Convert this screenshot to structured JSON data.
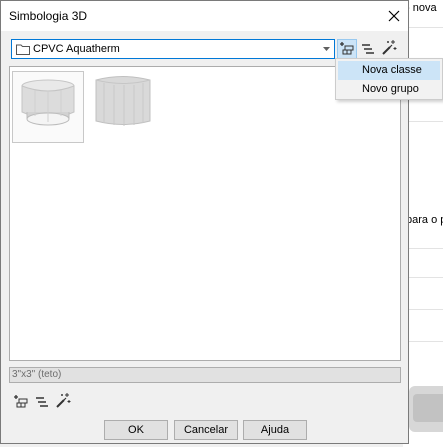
{
  "dialog": {
    "title": "Simbologia 3D",
    "library_combo": {
      "value": "CPVC Aquatherm"
    },
    "toolbar_top": [
      "new-class-icon",
      "list-icon",
      "magic-wand-icon"
    ],
    "dropdown_menu": {
      "items": [
        "Nova classe",
        "Novo grupo"
      ],
      "highlighted": "Nova classe"
    },
    "gallery": {
      "items": [
        "fitting-cap-icon",
        "fitting-octagonal-icon"
      ],
      "selected_index": 0
    },
    "status_text": "3\"x3\" (teto)",
    "buttons": {
      "ok": "OK",
      "cancel": "Cancelar",
      "help": "Ajuda"
    }
  },
  "background_app": {
    "text_top": "- nova",
    "text_mid": "para o p"
  },
  "colors": {
    "focus_blue": "#0078d7",
    "menu_highlight": "#cce4f7",
    "dialog_bg": "#f0f0f0"
  }
}
